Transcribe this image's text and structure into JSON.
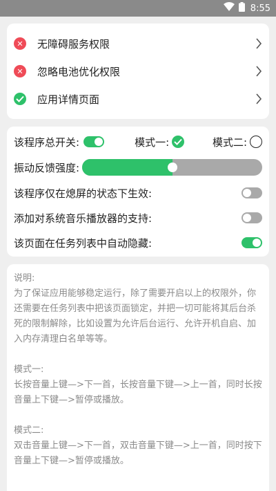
{
  "statusbar": {
    "time": "8:55"
  },
  "permissions": [
    {
      "label": "无障碍服务权限",
      "status": "error"
    },
    {
      "label": "忽略电池优化权限",
      "status": "error"
    },
    {
      "label": "应用详情页面",
      "status": "ok"
    }
  ],
  "settings": {
    "master_switch_label": "该程序总开关:",
    "master_switch_on": true,
    "mode1_label": "模式一:",
    "mode1_selected": true,
    "mode2_label": "模式二:",
    "mode2_selected": false,
    "vibration_label": "振动反馈强度:",
    "vibration_level": 0.5,
    "screen_off_label": "该程序仅在熄屏的状态下生效:",
    "screen_off_on": false,
    "music_player_label": "添加对系统音乐播放器的支持:",
    "music_player_on": false,
    "auto_hide_label": "该页面在任务列表中自动隐藏:",
    "auto_hide_on": true
  },
  "description": {
    "text": "说明:\n为了保证应用能够稳定运行，除了需要开启以上的权限外，你还需要在任务列表中把该页面锁定，并把一切可能将其后台杀死的限制解除，比如设置为允许后台运行、允许开机自启、加入内存清理白名单等等。\n\n模式一:\n长按音量上键—>下一首，长按音量下键—>上一首，同时长按音量上下键—>暂停或播放。\n\n模式二:\n双击音量上键—>下一首，双击音量下键—>上一首，同时按下音量上下键—>暂停或播放。"
  },
  "colors": {
    "accent": "#2ec16a",
    "error": "#ef4b57",
    "off": "#a9a9a9"
  }
}
